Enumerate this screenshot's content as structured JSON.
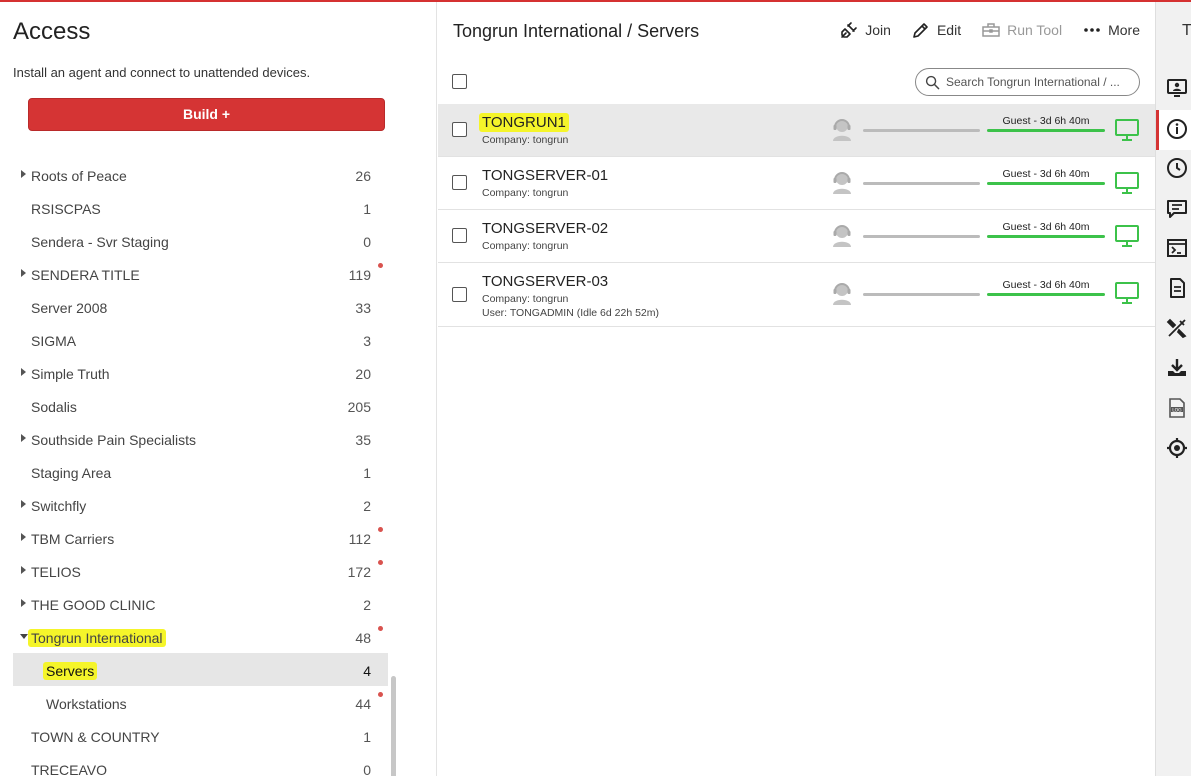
{
  "left": {
    "title": "Access",
    "subtitle": "Install an agent and connect to unattended devices.",
    "build_label": "Build +",
    "groups": [
      {
        "name": "Roots of Peace",
        "count": "26",
        "arrow": true,
        "dot": false
      },
      {
        "name": "RSISCPAS",
        "count": "1",
        "arrow": false,
        "dot": false
      },
      {
        "name": "Sendera - Svr Staging",
        "count": "0",
        "arrow": false,
        "dot": false
      },
      {
        "name": "SENDERA TITLE",
        "count": "119",
        "arrow": true,
        "dot": true
      },
      {
        "name": "Server 2008",
        "count": "33",
        "arrow": false,
        "dot": false
      },
      {
        "name": "SIGMA",
        "count": "3",
        "arrow": false,
        "dot": false
      },
      {
        "name": "Simple Truth",
        "count": "20",
        "arrow": true,
        "dot": false
      },
      {
        "name": "Sodalis",
        "count": "205",
        "arrow": false,
        "dot": false
      },
      {
        "name": "Southside Pain Specialists",
        "count": "35",
        "arrow": true,
        "dot": false
      },
      {
        "name": "Staging Area",
        "count": "1",
        "arrow": false,
        "dot": false
      },
      {
        "name": "Switchfly",
        "count": "2",
        "arrow": true,
        "dot": false
      },
      {
        "name": "TBM Carriers",
        "count": "112",
        "arrow": true,
        "dot": true
      },
      {
        "name": "TELIOS",
        "count": "172",
        "arrow": true,
        "dot": true
      },
      {
        "name": "THE GOOD CLINIC",
        "count": "2",
        "arrow": true,
        "dot": false
      },
      {
        "name": "Tongrun International",
        "count": "48",
        "arrow": true,
        "dot": true,
        "expanded": true
      },
      {
        "name": "Servers",
        "count": "4",
        "arrow": false,
        "dot": false,
        "child": true,
        "selected": true
      },
      {
        "name": "Workstations",
        "count": "44",
        "arrow": false,
        "dot": true,
        "child": true
      },
      {
        "name": "TOWN & COUNTRY",
        "count": "1",
        "arrow": false,
        "dot": false
      },
      {
        "name": "TRECEAVO",
        "count": "0",
        "arrow": false,
        "dot": false
      }
    ]
  },
  "main": {
    "title": "Tongrun International / Servers",
    "toolbar": {
      "join": "Join",
      "edit": "Edit",
      "run_tool": "Run Tool",
      "more": "More"
    },
    "search_placeholder": "Search Tongrun International / ...",
    "rows": [
      {
        "name": "TONGRUN1",
        "company": "Company: tongrun",
        "user": "",
        "guest": "Guest - 3d 6h 40m",
        "selected": true
      },
      {
        "name": "TONGSERVER-01",
        "company": "Company: tongrun",
        "user": "",
        "guest": "Guest - 3d 6h 40m"
      },
      {
        "name": "TONGSERVER-02",
        "company": "Company: tongrun",
        "user": "",
        "guest": "Guest - 3d 6h 40m"
      },
      {
        "name": "TONGSERVER-03",
        "company": "Company: tongrun",
        "user": "User: TONGADMIN (Idle 6d 22h 52m)",
        "guest": "Guest - 3d 6h 40m"
      }
    ]
  },
  "rail": {
    "tab_letter": "T",
    "icons": [
      "monitor-user-icon",
      "info-icon",
      "clock-icon",
      "chat-icon",
      "terminal-icon",
      "document-icon",
      "tools-icon",
      "download-icon",
      "log-icon",
      "target-icon"
    ]
  },
  "colors": {
    "accent": "#d53434",
    "online": "#3cc24a",
    "highlight": "#f5f52a"
  }
}
